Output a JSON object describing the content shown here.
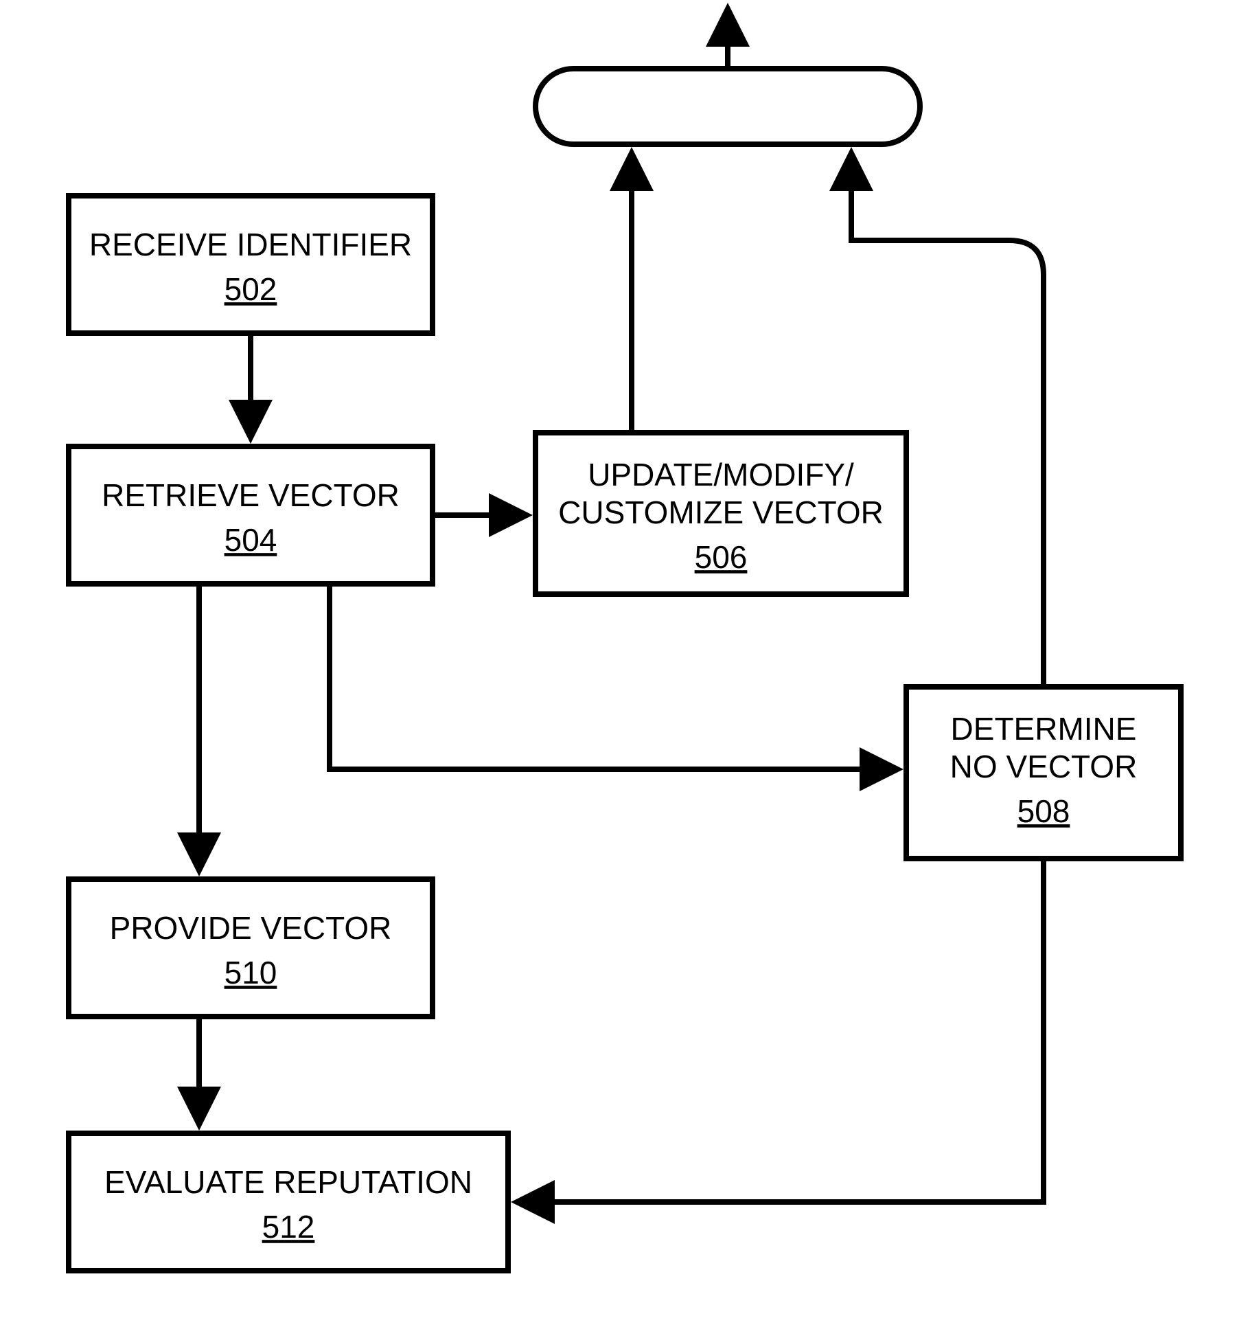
{
  "nodes": {
    "n502": {
      "label": "RECEIVE IDENTIFIER",
      "ref": "502"
    },
    "n504": {
      "label": "RETRIEVE VECTOR",
      "ref": "504"
    },
    "n506": {
      "label1": "UPDATE/MODIFY/",
      "label2": "CUSTOMIZE VECTOR",
      "ref": "506"
    },
    "n508": {
      "label1": "DETERMINE",
      "label2": "NO VECTOR",
      "ref": "508"
    },
    "n510": {
      "label": "PROVIDE VECTOR",
      "ref": "510"
    },
    "n512": {
      "label": "EVALUATE REPUTATION",
      "ref": "512"
    }
  }
}
